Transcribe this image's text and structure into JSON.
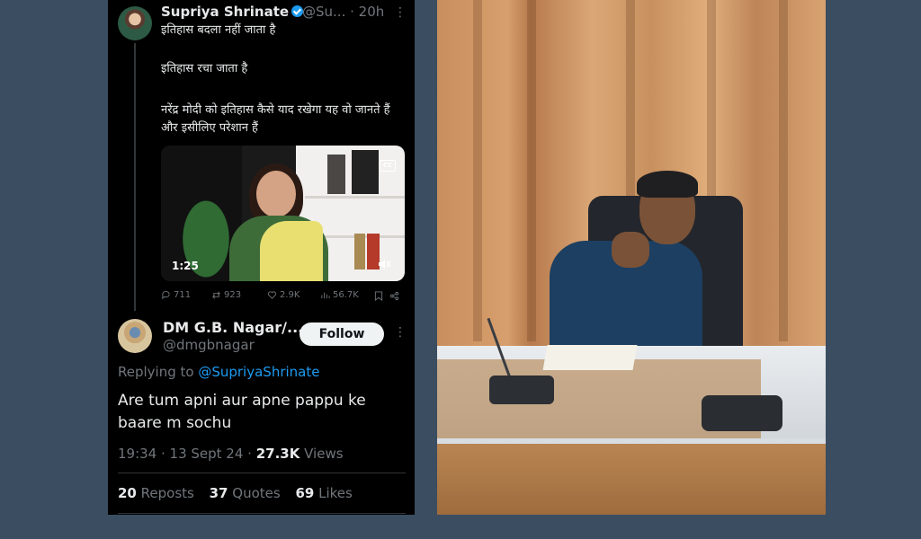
{
  "tweet1": {
    "author_name": "Supriya Shrinate",
    "author_handle": "@Su...",
    "time": "· 20h",
    "more": "⋮",
    "lines": [
      "इतिहास बदला नहीं जाता है",
      "इतिहास रचा जाता है",
      "नरेंद्र मोदी को इतिहास कैसे याद रखेगा यह वो जानते हैं और इसीलिए परेशान हैं"
    ],
    "media": {
      "duration": "1:25",
      "cc": "CC"
    },
    "actions": {
      "replies": "711",
      "reposts": "923",
      "likes": "2.9K",
      "views": "56.7K"
    }
  },
  "tweet2": {
    "author_name": "DM G.B. Nagar/...",
    "author_handle": "@dmgbnagar",
    "follow_label": "Follow",
    "more": "⋮",
    "replying_prefix": "Replying to ",
    "replying_to": "@SupriyaShrinate",
    "text": "Are tum apni aur apne pappu ke baare m sochu",
    "time": "19:34 · 13 Sept 24 · ",
    "views_count": "27.3K",
    "views_label": " Views",
    "stats": {
      "reposts_count": "20",
      "reposts_label": " Reposts",
      "quotes_count": "37",
      "quotes_label": " Quotes",
      "likes_count": "69",
      "likes_label": " Likes"
    }
  },
  "colors": {
    "accent": "#1d9bf0",
    "panel_bg": "#000000",
    "page_bg": "#3b4d60"
  }
}
